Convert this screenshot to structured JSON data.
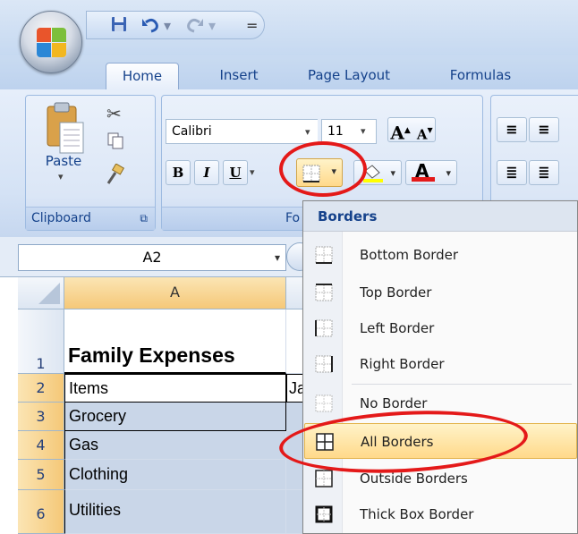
{
  "quick_access": {
    "save_icon": "save-icon",
    "undo_icon": "undo-icon",
    "redo_icon": "redo-icon",
    "customize": "="
  },
  "tabs": [
    "Home",
    "Insert",
    "Page Layout",
    "Formulas"
  ],
  "font": {
    "name": "Calibri",
    "size": "11",
    "grow_label": "A",
    "shrink_label": "A",
    "bold": "B",
    "italic": "I",
    "underline": "U",
    "font_color_letter": "A"
  },
  "clipboard": {
    "paste_label": "Paste",
    "group_label": "Clipboard"
  },
  "font_group_label_partial": "Fo",
  "name_box": "A2",
  "columns": [
    "A"
  ],
  "rows": [
    {
      "num": "1",
      "a": "Family Expenses",
      "b": ""
    },
    {
      "num": "2",
      "a": "Items",
      "b": "Ja"
    },
    {
      "num": "3",
      "a": "Grocery",
      "b": ""
    },
    {
      "num": "4",
      "a": "Gas",
      "b": ""
    },
    {
      "num": "5",
      "a": "Clothing",
      "b": ""
    },
    {
      "num": "6",
      "a": "Utilities",
      "b": ""
    }
  ],
  "borders_menu": {
    "title": "Borders",
    "items": [
      {
        "label": "Bottom Border",
        "icon": "bottom-border-icon"
      },
      {
        "label": "Top Border",
        "icon": "top-border-icon"
      },
      {
        "label": "Left Border",
        "icon": "left-border-icon"
      },
      {
        "label": "Right Border",
        "icon": "right-border-icon"
      },
      {
        "label": "No Border",
        "icon": "no-border-icon"
      },
      {
        "label": "All Borders",
        "icon": "all-borders-icon"
      },
      {
        "label": "Outside Borders",
        "icon": "outside-borders-icon"
      },
      {
        "label": "Thick Box Border",
        "icon": "thick-box-border-icon"
      }
    ]
  },
  "colors": {
    "highlight_circle": "#e41919",
    "menu_hover": "#ffd98a",
    "ribbon_blue": "#d4e2f5"
  }
}
